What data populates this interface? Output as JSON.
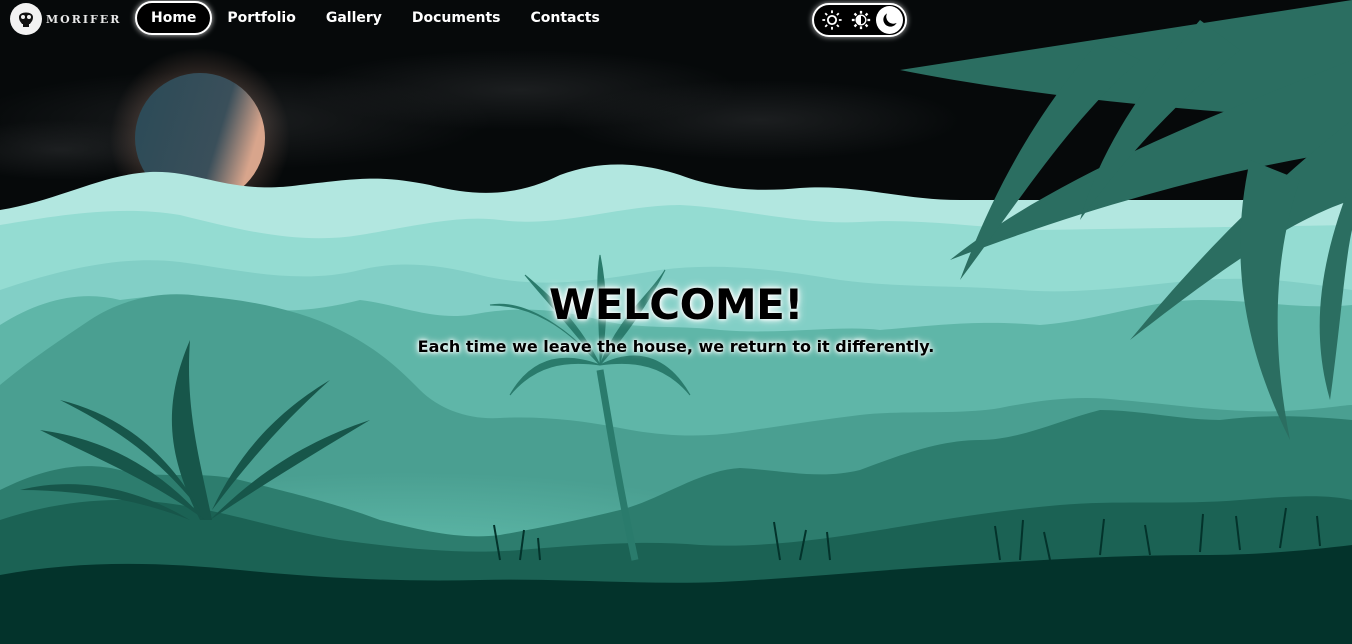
{
  "brand": {
    "name": "MORIFER",
    "logo_icon": "skull-logo-icon"
  },
  "nav": {
    "items": [
      {
        "label": "Home",
        "active": true
      },
      {
        "label": "Portfolio",
        "active": false
      },
      {
        "label": "Gallery",
        "active": false
      },
      {
        "label": "Documents",
        "active": false
      },
      {
        "label": "Contacts",
        "active": false
      }
    ]
  },
  "theme_switch": {
    "options": [
      {
        "name": "light",
        "icon": "sun-icon"
      },
      {
        "name": "auto",
        "icon": "half-sun-icon"
      },
      {
        "name": "dark",
        "icon": "moon-icon"
      }
    ],
    "selected": "dark"
  },
  "hero": {
    "title": "WELCOME!",
    "subtitle": "Each time we leave the house, we return to it differently."
  },
  "colors": {
    "sky": "#06090a",
    "mountains_far": "#a8e4dc",
    "jungle_mid": "#4fa99a",
    "jungle_dark": "#1f6c5e",
    "ground": "#02312a",
    "fern": "#2a6e61"
  }
}
